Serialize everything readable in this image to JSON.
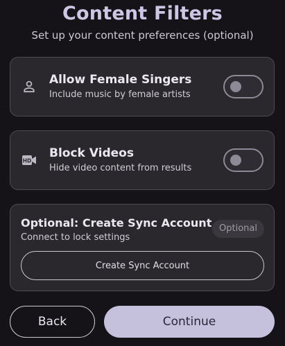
{
  "header": {
    "title": "Content Filters",
    "subtitle": "Set up your content preferences (optional)"
  },
  "filters": {
    "female_singers": {
      "icon": "person-icon",
      "title": "Allow Female Singers",
      "description": "Include music by female artists",
      "enabled": false
    },
    "block_videos": {
      "icon": "hd-video-icon",
      "title": "Block Videos",
      "description": "Hide video content from results",
      "enabled": false
    }
  },
  "sync": {
    "title": "Optional: Create Sync Account",
    "description": "Connect to lock settings",
    "badge": "Optional",
    "button_label": "Create Sync Account"
  },
  "footer": {
    "back_label": "Back",
    "continue_label": "Continue"
  },
  "colors": {
    "background": "#151318",
    "card": "#2a282d",
    "accent": "#c5c1dc",
    "title": "#cdc6e4"
  }
}
